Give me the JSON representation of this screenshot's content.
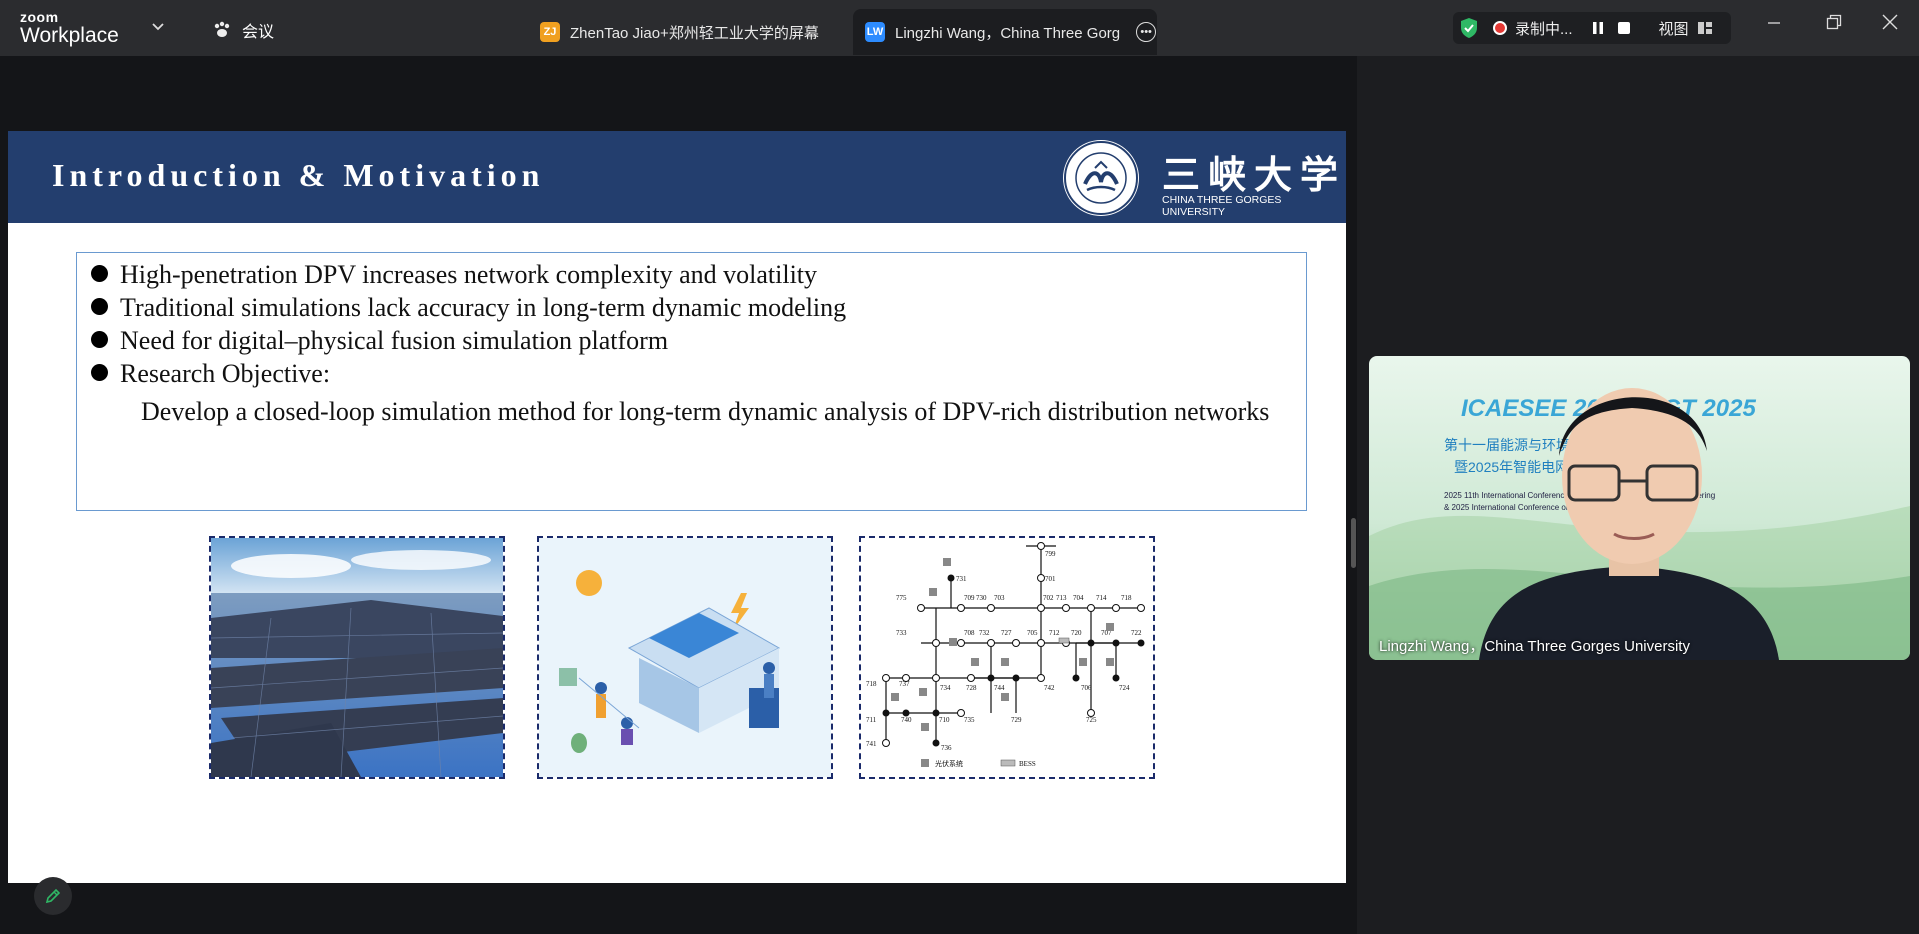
{
  "app": {
    "brand_top": "zoom",
    "brand_bottom": "Workplace",
    "meeting_label": "会议"
  },
  "tabs": [
    {
      "avatar": "ZJ",
      "avatar_color": "#f0a020",
      "title": "ZhenTao Jiao+郑州轻工业大学的屏幕"
    },
    {
      "avatar": "LW",
      "avatar_color": "#2d8cff",
      "title": "Lingzhi Wang，China Three Gorg"
    }
  ],
  "recording": {
    "status": "录制中...",
    "view_label": "视图"
  },
  "slide": {
    "title": "Introduction & Motivation",
    "university_cn": "三峡大学",
    "university_en": "CHINA THREE GORGES UNIVERSITY",
    "bullets": [
      "High-penetration DPV increases network complexity and volatility",
      "Traditional simulations lack accuracy in long-term dynamic modeling",
      "Need for digital–physical fusion simulation platform",
      "Research Objective:"
    ],
    "objective": "Develop a closed-loop simulation method for long-term dynamic analysis of DPV-rich distribution networks",
    "diagram": {
      "nodes": [
        "799",
        "731",
        "701",
        "775",
        "709",
        "730",
        "703",
        "702",
        "713",
        "704",
        "714",
        "718",
        "733",
        "708",
        "732",
        "727",
        "705",
        "712",
        "720",
        "707",
        "722",
        "734",
        "744",
        "742",
        "706",
        "724",
        "728",
        "737",
        "711",
        "740",
        "710",
        "735",
        "729",
        "725",
        "741",
        "736"
      ],
      "legend_pv": "光伏系统",
      "legend_bess": "BESS"
    }
  },
  "participant": {
    "name_label": "Lingzhi Wang，China Three Gorges University",
    "backdrop_title": "ICAESEE 2025 / SGT 2025",
    "backdrop_line1": "第十一届能源与环境工程国际学术会议",
    "backdrop_line2": "暨2025年智能电网技术国际学术会议",
    "backdrop_en1": "2025 11th International Conference on Energy and Environment Engineering",
    "backdrop_en2": "& 2025 International Conference on Smart Grid Technologies"
  }
}
